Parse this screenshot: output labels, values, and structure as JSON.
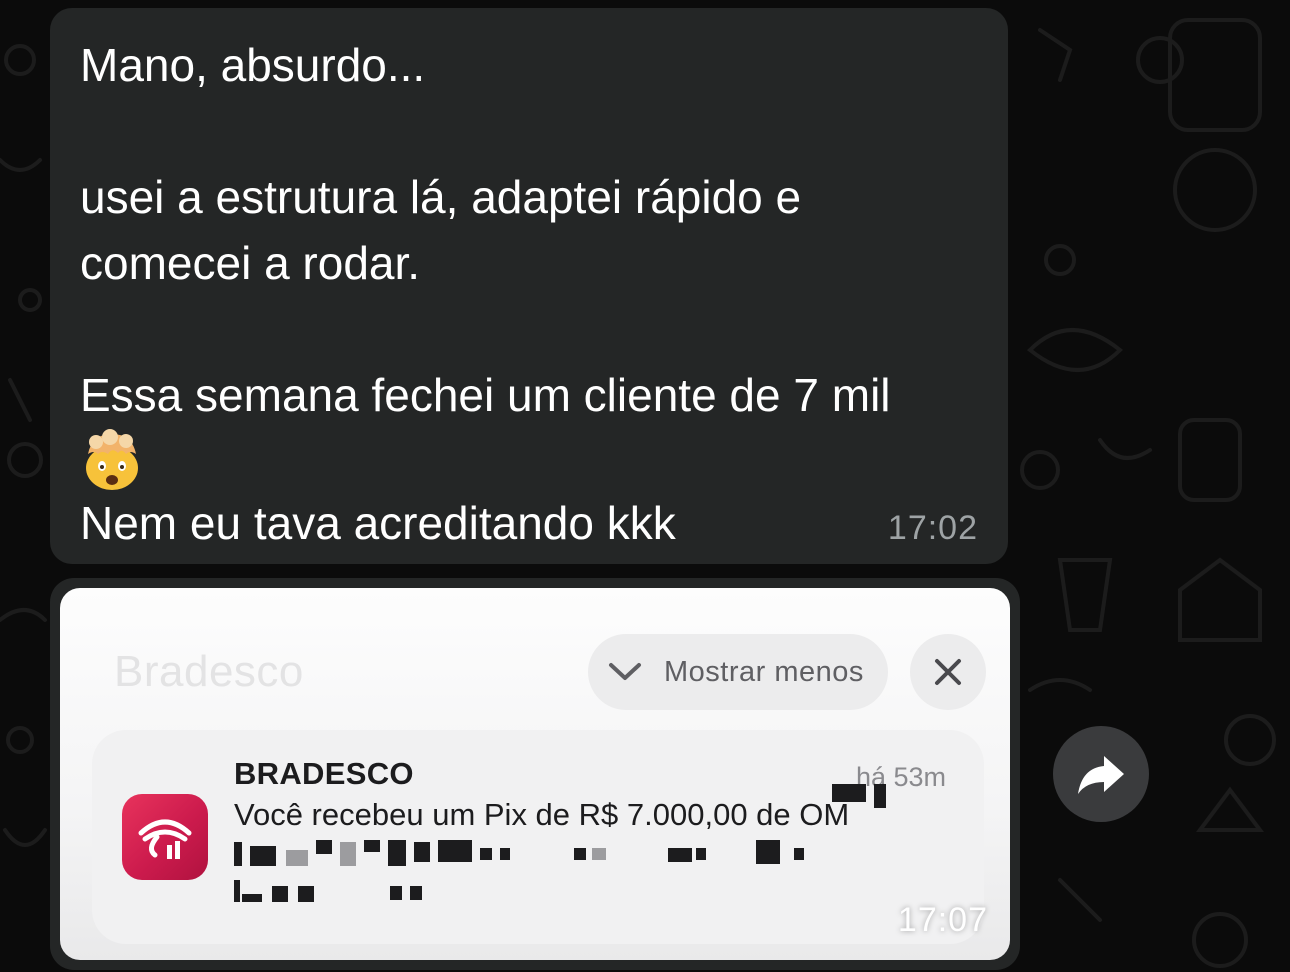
{
  "message_text": {
    "line1": "Mano, absurdo...",
    "line2": "usei a estrutura lá, adaptei rápido e",
    "line3": "comecei a rodar.",
    "line4": "Essa semana fechei um cliente de 7 mil",
    "emoji": "exploding-head",
    "line5": "Nem eu tava acreditando kkk",
    "timestamp": "17:02"
  },
  "image_message": {
    "notification": {
      "app_name": "Bradesco",
      "show_less_label": "Mostrar menos",
      "sender": "BRADESCO",
      "time_ago": "há 53m",
      "body": "Você recebeu um Pix de R$ 7.000,00 de OM"
    },
    "timestamp": "17:07"
  },
  "colors": {
    "bubble": "#242626",
    "background": "#0b0b0b",
    "bank_red": "#cc1b4d"
  },
  "icons": [
    "chevron-down-icon",
    "close-icon",
    "bradesco-logo-icon",
    "forward-icon"
  ]
}
